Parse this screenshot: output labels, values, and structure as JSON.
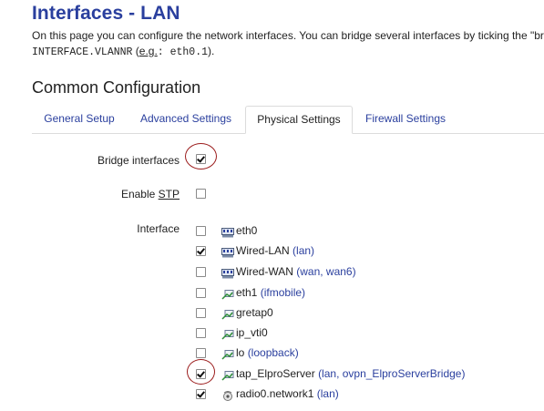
{
  "page": {
    "title": "Interfaces - LAN",
    "description_text": "On this page you can configure the network interfaces. You can bridge several interfaces by ticking the \"bridg",
    "description_mono": "INTERFACE.VLANNR",
    "description_eg_open": " (",
    "description_eg": "e.g.",
    "description_mono2": ": eth0.1",
    "description_close": ")."
  },
  "section": {
    "title": "Common Configuration"
  },
  "tabs": [
    {
      "label": "General Setup",
      "active": false
    },
    {
      "label": "Advanced Settings",
      "active": false
    },
    {
      "label": "Physical Settings",
      "active": true
    },
    {
      "label": "Firewall Settings",
      "active": false
    }
  ],
  "form": {
    "bridge_label": "Bridge interfaces",
    "bridge_checked": true,
    "stp_label_prefix": "Enable ",
    "stp_label_u": "STP",
    "stp_checked": false,
    "interface_label": "Interface"
  },
  "interfaces": [
    {
      "name": "eth0",
      "networks": "",
      "checked": false,
      "icon": "ethernet-icon"
    },
    {
      "name": "Wired-LAN",
      "networks": "(lan)",
      "checked": true,
      "icon": "ethernet-icon"
    },
    {
      "name": "Wired-WAN",
      "networks": "(wan, wan6)",
      "checked": false,
      "icon": "ethernet-icon"
    },
    {
      "name": "eth1",
      "networks": "(ifmobile)",
      "checked": false,
      "icon": "tunnel-icon"
    },
    {
      "name": "gretap0",
      "networks": "",
      "checked": false,
      "icon": "tunnel-icon"
    },
    {
      "name": "ip_vti0",
      "networks": "",
      "checked": false,
      "icon": "tunnel-icon"
    },
    {
      "name": "lo",
      "networks": "(loopback)",
      "checked": false,
      "icon": "tunnel-icon"
    },
    {
      "name": "tap_ElproServer",
      "networks": "(lan, ovpn_ElproServerBridge)",
      "checked": true,
      "icon": "tunnel-icon"
    },
    {
      "name": "radio0.network1",
      "networks": "(lan)",
      "checked": true,
      "icon": "wireless-icon"
    }
  ],
  "colors": {
    "title": "#2a3f9e",
    "link": "#2a3f9e",
    "annotation": "#9b1c1c"
  }
}
